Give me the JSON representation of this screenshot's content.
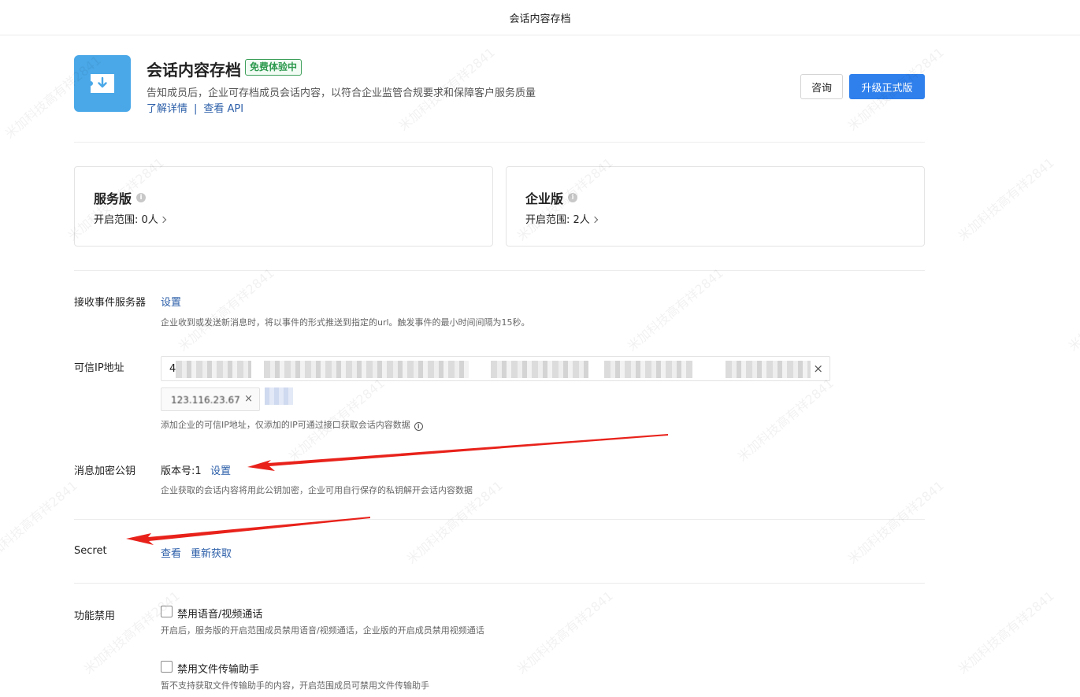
{
  "topbar": {
    "title": "会话内容存档"
  },
  "app": {
    "title": "会话内容存档",
    "badge": "免费体验中",
    "description": "告知成员后，企业可存档成员会话内容，以符合企业监管合规要求和保障客户服务质量",
    "link_details": "了解详情",
    "link_separator": "|",
    "link_api": "查看 API",
    "btn_consult": "咨询",
    "btn_upgrade": "升级正式版"
  },
  "cards": [
    {
      "title": "服务版",
      "range": "开启范围: 0人"
    },
    {
      "title": "企业版",
      "range": "开启范围: 2人"
    }
  ],
  "settings": {
    "event_server": {
      "label": "接收事件服务器",
      "action": "设置",
      "hint": "企业收到或发送新消息时，将以事件的形式推送到指定的url。触发事件的最小时间间隔为15秒。"
    },
    "trusted_ip": {
      "label": "可信IP地址",
      "first_value": "4",
      "tag_value": "123.116.23.67",
      "hint": "添加企业的可信IP地址，仅添加的IP可通过接口获取会话内容数据"
    },
    "encryption": {
      "label": "消息加密公钥",
      "version": "版本号:1",
      "action": "设置",
      "hint": "企业获取的会话内容将用此公钥加密，企业可用自行保存的私钥解开会话内容数据"
    },
    "secret": {
      "label": "Secret",
      "view": "查看",
      "refresh": "重新获取"
    },
    "disable": {
      "label": "功能禁用",
      "options": [
        {
          "label": "禁用语音/视频通话",
          "hint": "开启后，服务版的开启范围成员禁用语音/视频通话，企业版的开启成员禁用视频通话",
          "checked": false
        },
        {
          "label": "禁用文件传输助手",
          "hint": "暂不支持获取文件传输助手的内容，开启范围成员可禁用文件传输助手",
          "checked": false
        }
      ]
    }
  },
  "watermark": "米加科技高有祥2841",
  "colors": {
    "primary": "#2f80ed",
    "link": "#2b5ea8",
    "badge": "#2e9a4f",
    "app_icon": "#4aa8e8",
    "annotation_arrow": "#e8221b"
  },
  "icons": {
    "app": "download-box-icon",
    "info": "info-icon",
    "chevron": "chevron-right-icon",
    "clear": "close-icon"
  }
}
